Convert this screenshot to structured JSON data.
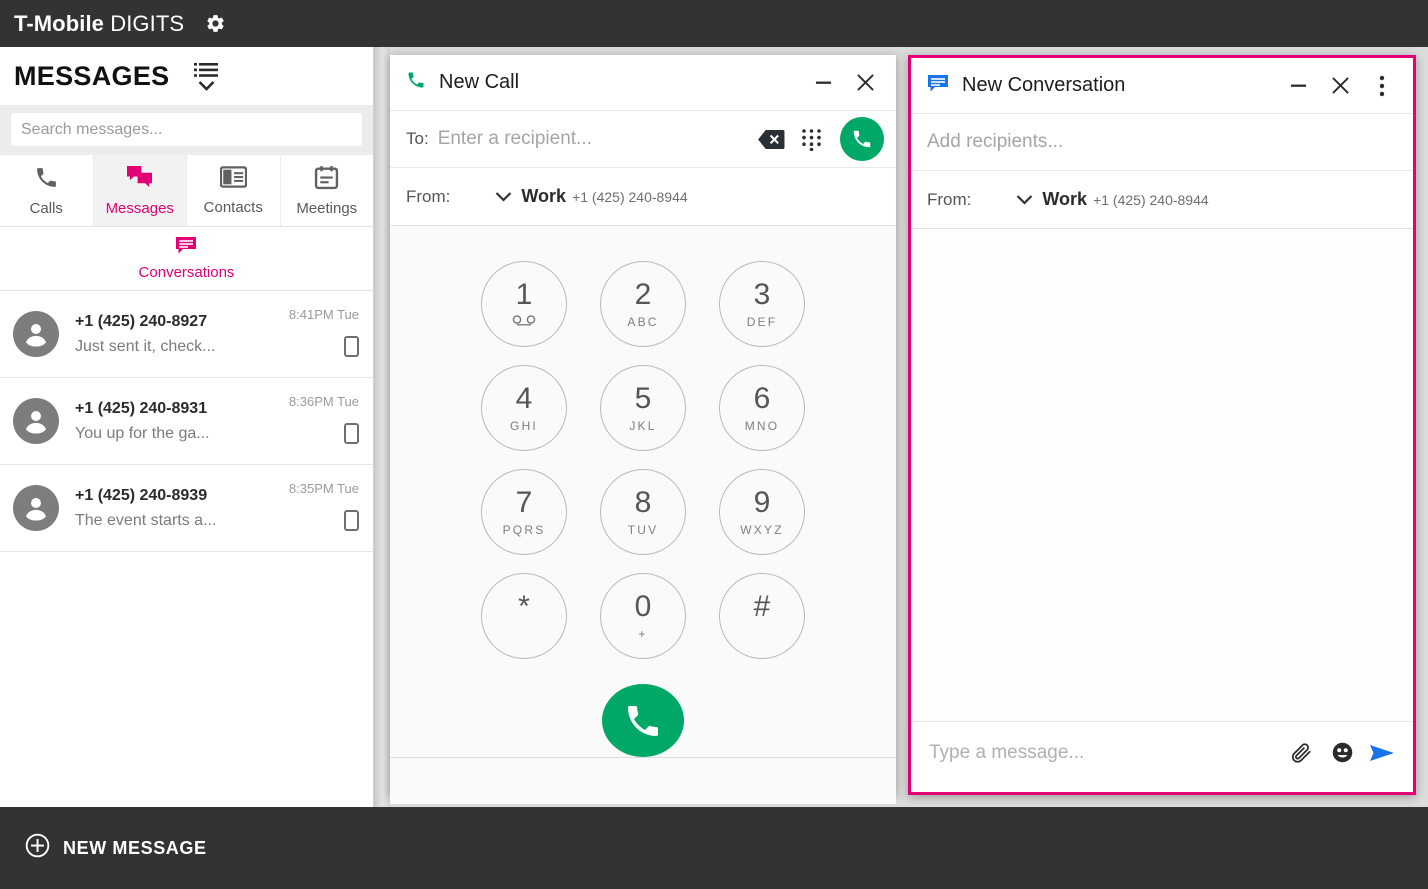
{
  "colors": {
    "magenta": "#e20074",
    "green": "#00a868",
    "dark_bar": "#333333",
    "send_blue": "#1a73e8"
  },
  "topbar": {
    "brand_strong": "T-Mobile",
    "brand_light": "DIGITS",
    "settings_icon": "gear-icon"
  },
  "left_panel": {
    "title": "MESSAGES",
    "list_options_icon": "list-options-icon",
    "search": {
      "value": "",
      "placeholder": "Search messages..."
    },
    "tabs": [
      {
        "label": "Calls",
        "icon": "phone-icon",
        "active": false
      },
      {
        "label": "Messages",
        "icon": "message-icon",
        "active": true
      },
      {
        "label": "Contacts",
        "icon": "contacts-icon",
        "active": false
      },
      {
        "label": "Meetings",
        "icon": "calendar-icon",
        "active": false
      }
    ],
    "subtabs": [
      {
        "label": "Conversations",
        "icon": "conversation-icon",
        "active": true
      }
    ],
    "conversations": [
      {
        "name": "+1 (425) 240-8927",
        "preview": "Just sent it, check...",
        "time": "8:41PM Tue",
        "device_icon": "mobile-device-icon"
      },
      {
        "name": "+1 (425) 240-8931",
        "preview": "You up for the ga...",
        "time": "8:36PM Tue",
        "device_icon": "mobile-device-icon"
      },
      {
        "name": "+1 (425) 240-8939",
        "preview": "The event starts a...",
        "time": "8:35PM Tue",
        "device_icon": "mobile-device-icon"
      }
    ]
  },
  "bottom_bar": {
    "new_message_label": "NEW MESSAGE",
    "new_message_icon": "plus-circle-icon"
  },
  "new_call_window": {
    "title": "New Call",
    "title_icon": "phone-icon",
    "minimize_label": "—",
    "close_label": "×",
    "to": {
      "label": "To:",
      "value": "",
      "placeholder": "Enter a recipient..."
    },
    "backspace_icon": "backspace-icon",
    "keypad_icon": "dialpad-icon",
    "call_icon": "phone-call-icon",
    "from": {
      "label": "From:",
      "chevron_icon": "chevron-down-icon",
      "name": "Work",
      "number": "+1 (425) 240-8944"
    },
    "keys": [
      {
        "digit": "1",
        "sub": "",
        "glyph": "voicemail-icon"
      },
      {
        "digit": "2",
        "sub": "ABC",
        "glyph": ""
      },
      {
        "digit": "3",
        "sub": "DEF",
        "glyph": ""
      },
      {
        "digit": "4",
        "sub": "GHI",
        "glyph": ""
      },
      {
        "digit": "5",
        "sub": "JKL",
        "glyph": ""
      },
      {
        "digit": "6",
        "sub": "MNO",
        "glyph": ""
      },
      {
        "digit": "7",
        "sub": "PQRS",
        "glyph": ""
      },
      {
        "digit": "8",
        "sub": "TUV",
        "glyph": ""
      },
      {
        "digit": "9",
        "sub": "WXYZ",
        "glyph": ""
      },
      {
        "digit": "*",
        "sub": "",
        "glyph": ""
      },
      {
        "digit": "0",
        "sub": "+",
        "glyph": ""
      },
      {
        "digit": "#",
        "sub": "",
        "glyph": ""
      }
    ]
  },
  "new_conversation_window": {
    "title": "New Conversation",
    "title_icon": "message-bubble-icon",
    "minimize_label": "—",
    "close_label": "×",
    "more_icon": "more-vertical-icon",
    "recipients": {
      "value": "",
      "placeholder": "Add recipients..."
    },
    "from": {
      "label": "From:",
      "chevron_icon": "chevron-down-icon",
      "name": "Work",
      "number": "+1 (425) 240-8944"
    },
    "compose": {
      "value": "",
      "placeholder": "Type a message...",
      "attach_icon": "paperclip-icon",
      "emoji_icon": "emoji-icon",
      "send_icon": "send-icon"
    }
  }
}
